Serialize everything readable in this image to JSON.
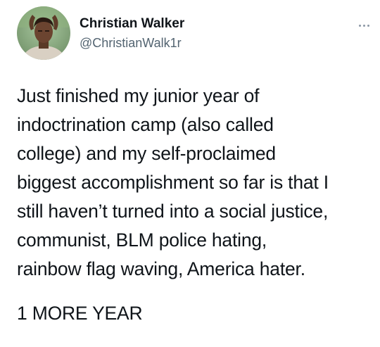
{
  "author": {
    "display_name": "Christian Walker",
    "handle": "@ChristianWalk1r",
    "avatar_icon": "profile-photo"
  },
  "more_icon": "more-horizontal-icon",
  "tweet": {
    "lines": [
      "Just finished my junior year of",
      "indoctrination camp (also called",
      "college) and my self-proclaimed",
      "biggest accomplishment so far is that I",
      "still haven’t turned into a social justice,",
      "communist, BLM police hating,",
      "rainbow flag waving, America hater."
    ],
    "closing": "1 MORE YEAR"
  },
  "colors": {
    "text": "#0f1419",
    "secondary": "#536471",
    "background": "#ffffff"
  }
}
